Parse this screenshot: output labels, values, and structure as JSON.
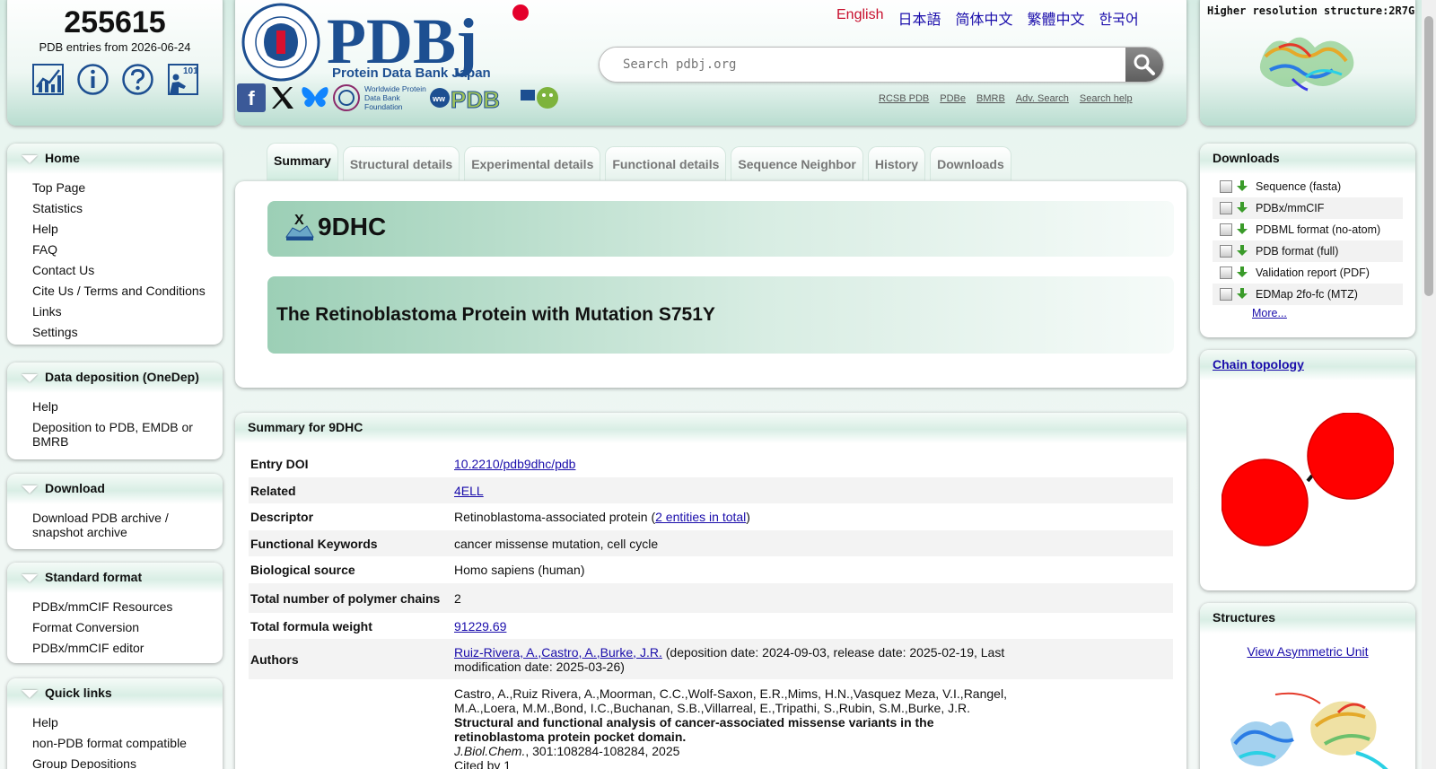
{
  "stats": {
    "entry_count": "255615",
    "entries_date_label": "PDB entries from 2026-06-24",
    "icons": [
      "statistics-icon",
      "info-icon",
      "help-icon",
      "pdb101-icon"
    ]
  },
  "header": {
    "logo_brand": "PDBj",
    "logo_subtitle": "Protein Data Bank Japan",
    "logo_seal_text": "PROTEIN DATA BANK JAPAN · THE UNIVERSITY OF OSAKA",
    "wwpdb_foundation": "Worldwide Protein Data Bank Foundation",
    "wwpdb_logo": "wwPDB",
    "social_icons": [
      "facebook-icon",
      "x-icon",
      "bluesky-icon"
    ],
    "languages": [
      "English",
      "日本語",
      "简体中文",
      "繁體中文",
      "한국어"
    ],
    "active_language": "English",
    "search_placeholder": "Search pdbj.org",
    "ext_links": [
      "RCSB PDB",
      "PDBe",
      "BMRB",
      "Adv. Search",
      "Search help"
    ]
  },
  "hires": {
    "title": "Higher resolution structure:2R7G"
  },
  "sidebar": {
    "home": {
      "title": "Home",
      "items": [
        "Top Page",
        "Statistics",
        "Help",
        "FAQ",
        "Contact Us",
        "Cite Us / Terms and Conditions",
        "Links",
        "Settings"
      ]
    },
    "deposition": {
      "title": "Data deposition (OneDep)",
      "items": [
        "Help",
        "Deposition to PDB, EMDB or BMRB"
      ]
    },
    "download": {
      "title": "Download",
      "items": [
        "Download PDB archive / snapshot archive"
      ]
    },
    "standard": {
      "title": "Standard format",
      "items": [
        "PDBx/mmCIF Resources",
        "Format Conversion",
        "PDBx/mmCIF editor"
      ]
    },
    "quick": {
      "title": "Quick links",
      "items": [
        "Help",
        "non-PDB format compatible",
        "Group Depositions"
      ]
    }
  },
  "tabs": [
    "Summary",
    "Structural details",
    "Experimental details",
    "Functional details",
    "Sequence Neighbor",
    "History",
    "Downloads"
  ],
  "entry": {
    "id": "9DHC",
    "title": "The Retinoblastoma Protein with Mutation S751Y"
  },
  "summary": {
    "heading": "Summary for 9DHC",
    "rows": {
      "doi_label": "Entry DOI",
      "doi_value": "10.2210/pdb9dhc/pdb",
      "related_label": "Related",
      "related_value": "4ELL",
      "descriptor_label": "Descriptor",
      "descriptor_value": "Retinoblastoma-associated protein (",
      "descriptor_link": "2 entities in total",
      "descriptor_close": ")",
      "keywords_label": "Functional Keywords",
      "keywords_value": "cancer missense mutation, cell cycle",
      "source_label": "Biological source",
      "source_value": "Homo sapiens (human)",
      "chains_label": "Total number of polymer chains",
      "chains_value": "2",
      "weight_label": "Total formula weight",
      "weight_value": "91229.69",
      "authors_label": "Authors",
      "authors_link": "Ruiz-Rivera, A.,Castro, A.,Burke, J.R.",
      "authors_dates": " (deposition date: 2024-09-03, release date: 2025-02-19, Last modification date: 2025-03-26)",
      "cite_authors": "Castro, A.,Ruiz Rivera, A.,Moorman, C.C.,Wolf-Saxon, E.R.,Mims, H.N.,Vasquez Meza, V.I.,Rangel, M.A.,Loera, M.M.,Bond, I.C.,Buchanan, S.B.,Villarreal, E.,Tripathi, S.,Rubin, S.M.,Burke, J.R.",
      "cite_title": "Structural and functional analysis of cancer-associated missense variants in the retinoblastoma protein pocket domain.",
      "cite_journal": "J.Biol.Chem.",
      "cite_volume": ", 301:108284-108284, 2025",
      "cite_count": "Cited by 1"
    }
  },
  "downloads": {
    "title": "Downloads",
    "items": [
      "Sequence (fasta)",
      "PDBx/mmCIF",
      "PDBML format (no-atom)",
      "PDB format (full)",
      "Validation report (PDF)",
      "EDMap 2fo-fc (MTZ)"
    ],
    "more": "More..."
  },
  "chain_topology": {
    "title": "Chain topology",
    "node_color": "#ff0000"
  },
  "structures": {
    "title": "Structures",
    "link": "View Asymmetric Unit"
  }
}
